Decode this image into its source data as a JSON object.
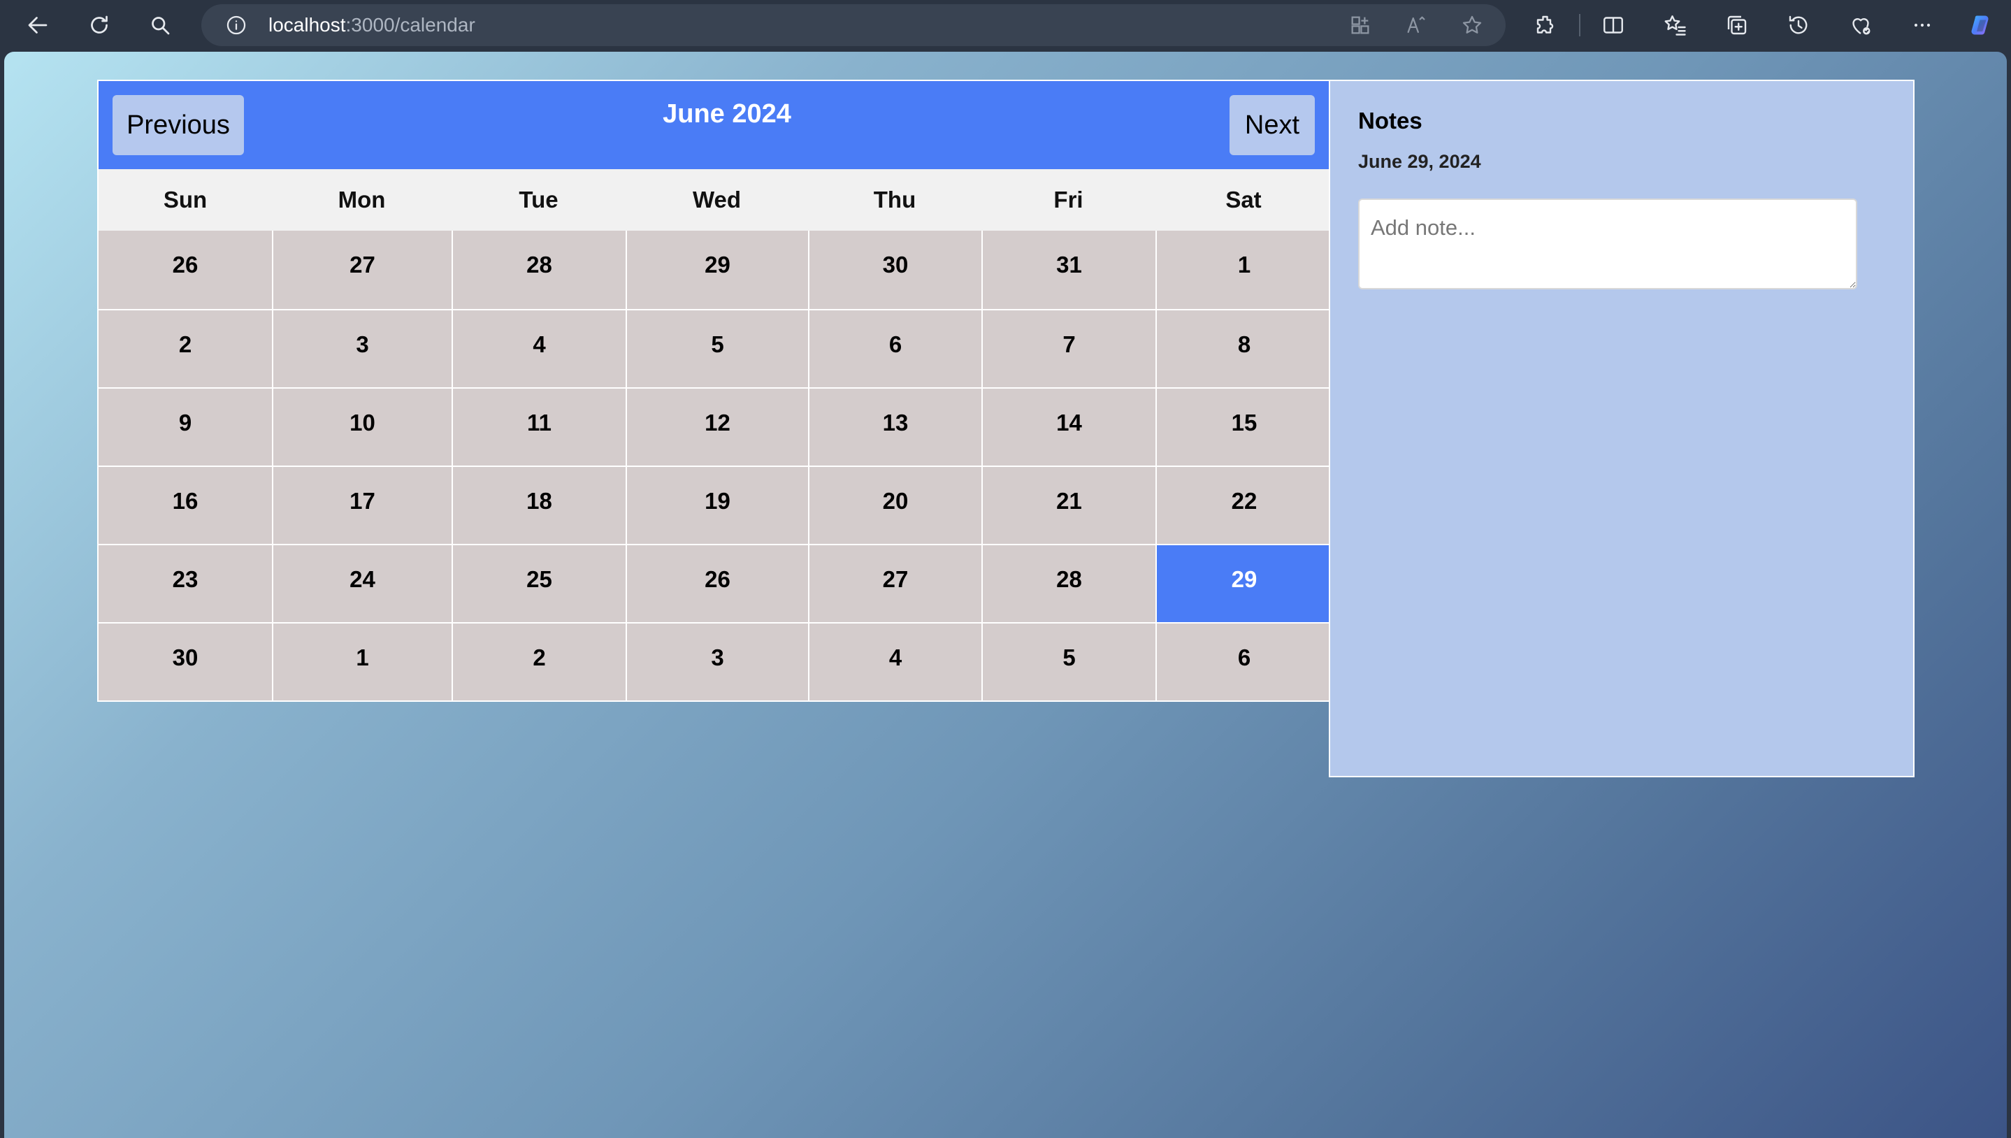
{
  "browser": {
    "url_host": "localhost",
    "url_path": ":3000/calendar"
  },
  "colors": {
    "header_blue": "#4a7cf6",
    "day_cell": "#d4cccc",
    "notes_panel": "#b4c8ec",
    "nav_button": "#b5c8ee"
  },
  "calendar": {
    "title": "June 2024",
    "prev_label": "Previous",
    "next_label": "Next",
    "weekdays": [
      "Sun",
      "Mon",
      "Tue",
      "Wed",
      "Thu",
      "Fri",
      "Sat"
    ],
    "weeks": [
      [
        "26",
        "27",
        "28",
        "29",
        "30",
        "31",
        "1"
      ],
      [
        "2",
        "3",
        "4",
        "5",
        "6",
        "7",
        "8"
      ],
      [
        "9",
        "10",
        "11",
        "12",
        "13",
        "14",
        "15"
      ],
      [
        "16",
        "17",
        "18",
        "19",
        "20",
        "21",
        "22"
      ],
      [
        "23",
        "24",
        "25",
        "26",
        "27",
        "28",
        "29"
      ],
      [
        "30",
        "1",
        "2",
        "3",
        "4",
        "5",
        "6"
      ]
    ],
    "selected_day": "29"
  },
  "notes": {
    "title": "Notes",
    "selected_date": "June 29, 2024",
    "placeholder": "Add note...",
    "value": ""
  }
}
